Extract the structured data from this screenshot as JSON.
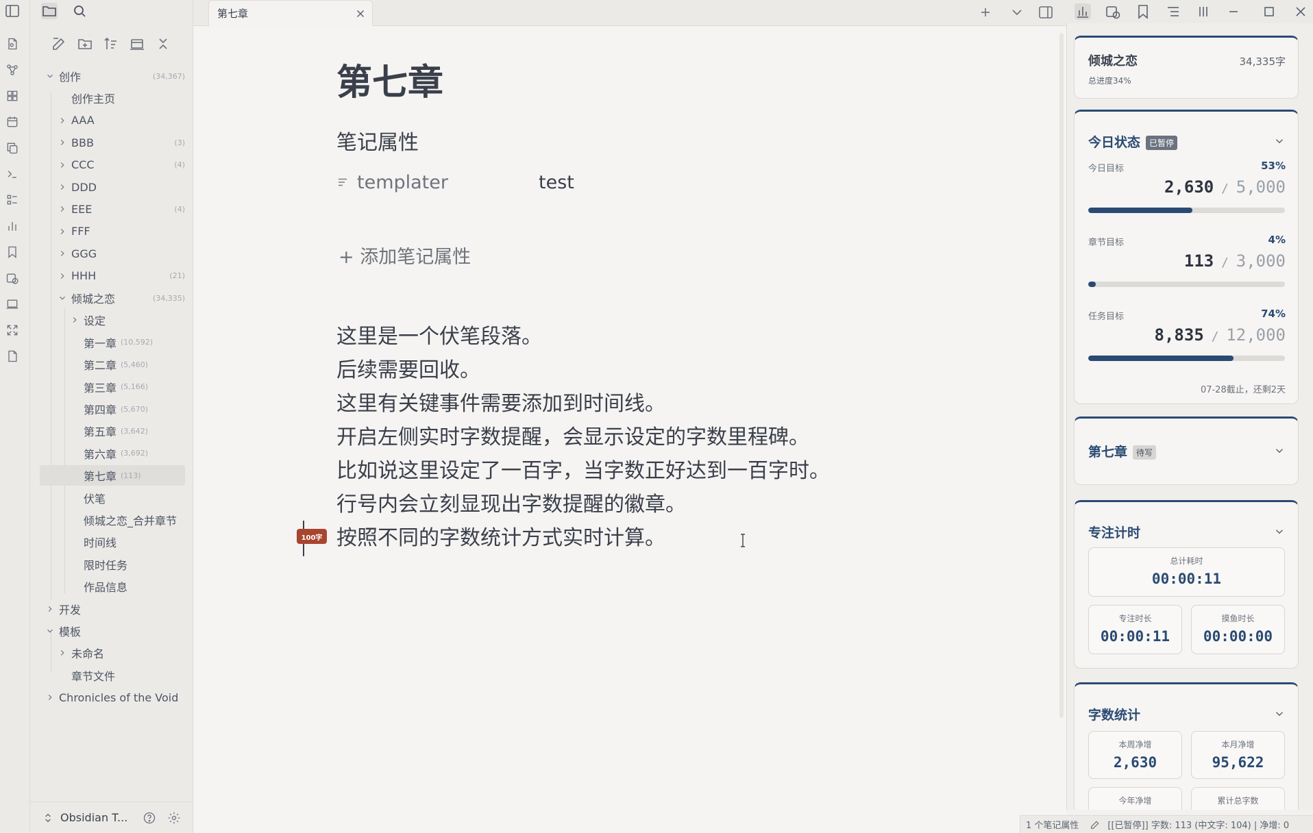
{
  "tab": {
    "title": "第七章"
  },
  "sidebar": {
    "tree": [
      {
        "label": "创作",
        "count": "(34,367)",
        "level": 0,
        "chevron": "down",
        "count_style": "right"
      },
      {
        "label": "创作主页",
        "count": "",
        "level": 1,
        "chevron": "none",
        "count_style": "right"
      },
      {
        "label": "AAA",
        "count": "",
        "level": 1,
        "chevron": "right",
        "count_style": "right"
      },
      {
        "label": "BBB",
        "count": "(3)",
        "level": 1,
        "chevron": "right",
        "count_style": "right"
      },
      {
        "label": "CCC",
        "count": "(4)",
        "level": 1,
        "chevron": "right",
        "count_style": "right"
      },
      {
        "label": "DDD",
        "count": "",
        "level": 1,
        "chevron": "right",
        "count_style": "right"
      },
      {
        "label": "EEE",
        "count": "(4)",
        "level": 1,
        "chevron": "right",
        "count_style": "right"
      },
      {
        "label": "FFF",
        "count": "",
        "level": 1,
        "chevron": "right",
        "count_style": "right"
      },
      {
        "label": "GGG",
        "count": "",
        "level": 1,
        "chevron": "right",
        "count_style": "right"
      },
      {
        "label": "HHH",
        "count": "(21)",
        "level": 1,
        "chevron": "right",
        "count_style": "right"
      },
      {
        "label": "倾城之恋",
        "count": "(34,335)",
        "level": 1,
        "chevron": "down",
        "count_style": "right"
      },
      {
        "label": "设定",
        "count": "",
        "level": 2,
        "chevron": "right",
        "count_style": "right"
      },
      {
        "label": "第一章",
        "count": "(10,592)",
        "level": 2,
        "chevron": "none",
        "count_style": "inline"
      },
      {
        "label": "第二章",
        "count": "(5,460)",
        "level": 2,
        "chevron": "none",
        "count_style": "inline"
      },
      {
        "label": "第三章",
        "count": "(5,166)",
        "level": 2,
        "chevron": "none",
        "count_style": "inline"
      },
      {
        "label": "第四章",
        "count": "(5,670)",
        "level": 2,
        "chevron": "none",
        "count_style": "inline"
      },
      {
        "label": "第五章",
        "count": "(3,642)",
        "level": 2,
        "chevron": "none",
        "count_style": "inline"
      },
      {
        "label": "第六章",
        "count": "(3,692)",
        "level": 2,
        "chevron": "none",
        "count_style": "inline"
      },
      {
        "label": "第七章",
        "count": "(113)",
        "level": 2,
        "chevron": "none",
        "count_style": "inline",
        "selected": true
      },
      {
        "label": "伏笔",
        "count": "",
        "level": 2,
        "chevron": "none",
        "count_style": "inline"
      },
      {
        "label": "倾城之恋_合并章节",
        "count": "",
        "level": 2,
        "chevron": "none",
        "count_style": "inline"
      },
      {
        "label": "时间线",
        "count": "",
        "level": 2,
        "chevron": "none",
        "count_style": "inline"
      },
      {
        "label": "限时任务",
        "count": "",
        "level": 2,
        "chevron": "none",
        "count_style": "inline"
      },
      {
        "label": "作品信息",
        "count": "",
        "level": 2,
        "chevron": "none",
        "count_style": "inline"
      },
      {
        "label": "开发",
        "count": "",
        "level": 0,
        "chevron": "right",
        "count_style": "right"
      },
      {
        "label": "模板",
        "count": "",
        "level": 0,
        "chevron": "down",
        "count_style": "right"
      },
      {
        "label": "未命名",
        "count": "",
        "level": 1,
        "chevron": "right",
        "count_style": "right"
      },
      {
        "label": "章节文件",
        "count": "",
        "level": 1,
        "chevron": "none",
        "count_style": "right"
      },
      {
        "label": "Chronicles of the Void",
        "count": "",
        "level": 0,
        "chevron": "right",
        "count_style": "right"
      }
    ],
    "vault_name": "Obsidian T..."
  },
  "editor": {
    "title": "第七章",
    "properties_title": "笔记属性",
    "property": {
      "key": "templater",
      "value": "test"
    },
    "add_property": "+ 添加笔记属性",
    "lines": [
      "这里是一个伏笔段落。",
      "后续需要回收。",
      "这里有关键事件需要添加到时间线。",
      "开启左侧实时字数提醒，会显示设定的字数里程碑。",
      "比如说这里设定了一百字，当字数正好达到一百字时。",
      "行号内会立刻显现出字数提醒的徽章。",
      "按照不同的字数统计方式实时计算。"
    ],
    "milestone_badge": "100字"
  },
  "panel": {
    "book": {
      "title": "倾城之恋",
      "words": "34,335字",
      "progress": "总进度34%"
    },
    "today": {
      "title": "今日状态",
      "tag": "已暂停",
      "goals": [
        {
          "label": "今日目标",
          "pct_text": "53%",
          "current": "2,630",
          "total": "5,000",
          "fraction": 0.53
        },
        {
          "label": "章节目标",
          "pct_text": "4%",
          "current": "113",
          "total": "3,000",
          "fraction": 0.04
        },
        {
          "label": "任务目标",
          "pct_text": "74%",
          "current": "8,835",
          "total": "12,000",
          "fraction": 0.74
        }
      ],
      "deadline": "07-28截止，还剩2天"
    },
    "chapter": {
      "title": "第七章",
      "tag": "待写"
    },
    "focus": {
      "title": "专注计时",
      "total_label": "总计耗时",
      "total_value": "00:00:11",
      "focus_label": "专注时长",
      "focus_value": "00:00:11",
      "slack_label": "摸鱼时长",
      "slack_value": "00:00:00"
    },
    "stats": {
      "title": "字数统计",
      "week_label": "本周净增",
      "week_value": "2,630",
      "month_label": "本月净增",
      "month_value": "95,622",
      "year_label": "今年净增",
      "total_label": "累计总字数"
    }
  },
  "status": {
    "properties": "1 个笔记属性",
    "words": "[[已暂停]] 字数: 113 (中文字: 104) | 净增: 0"
  },
  "colors": {
    "accent": "#2b4a73",
    "badge": "#a8452f"
  }
}
